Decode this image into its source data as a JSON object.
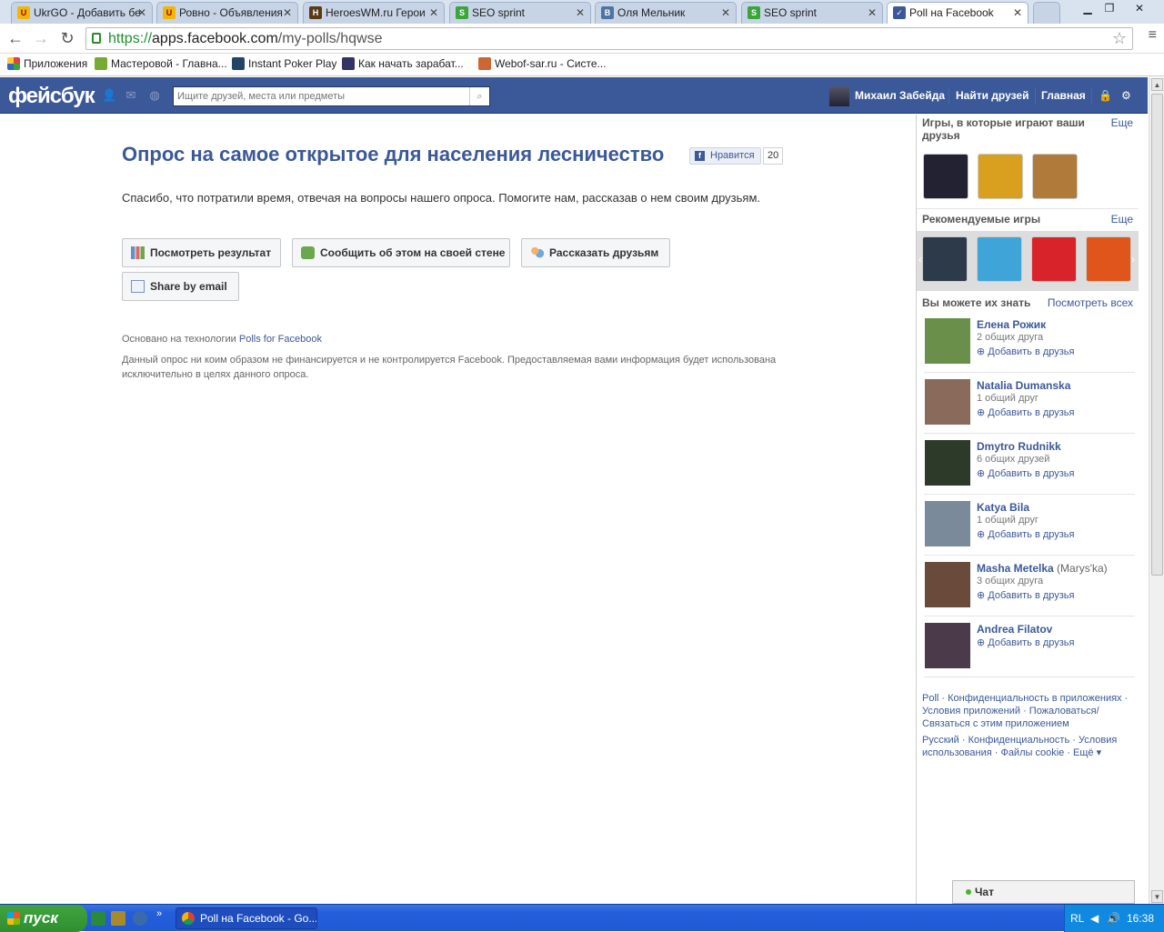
{
  "browser": {
    "tabs": [
      {
        "label": "UkrGO - Добавить бе",
        "icon": "ukrgo-icon",
        "color": "#f2b705"
      },
      {
        "label": "Ровно - Объявления",
        "icon": "ukrgo-icon",
        "color": "#f2b705"
      },
      {
        "label": "HeroesWM.ru Герои",
        "icon": "heroes-icon",
        "color": "#5a3a12"
      },
      {
        "label": "SEO sprint",
        "icon": "seosprint-icon",
        "color": "#3aa63a"
      },
      {
        "label": "Оля Мельник",
        "icon": "vk-icon",
        "color": "#4d75a3"
      },
      {
        "label": "SEO sprint",
        "icon": "seosprint-icon",
        "color": "#3aa63a"
      },
      {
        "label": "Poll на Facebook",
        "icon": "poll-icon",
        "color": "#3b5998"
      }
    ],
    "url": {
      "scheme": "https://",
      "host": "apps.facebook.com",
      "path": "/my-polls/hqwse"
    },
    "bookmarks": [
      {
        "label": "Приложения",
        "color": "#d44"
      },
      {
        "label": "Мастеровой - Главна...",
        "color": "#7a3"
      },
      {
        "label": "Instant Poker Play",
        "color": "#246"
      },
      {
        "label": "Как начать зарабат...",
        "color": "#336"
      },
      {
        "label": "Webof-sar.ru - Систе...",
        "color": "#c63"
      }
    ]
  },
  "fb": {
    "logo": "фейсбук",
    "search_placeholder": "Ищите друзей, места или предметы",
    "user_name": "Михаил Забейда",
    "nav_find_friends": "Найти друзей",
    "nav_home": "Главная"
  },
  "poll": {
    "title": "Опрос на самое открытое для населения лесничество",
    "like_label": "Нравится",
    "like_count": "20",
    "thanks": "Спасибо, что потратили время, отвечая на вопросы нашего опроса. Помогите нам, рассказав о нем своим друзьям.",
    "btn_results": "Посмотреть результат",
    "btn_wall": "Сообщить об этом на своей стене",
    "btn_tell": "Рассказать друзьям",
    "btn_email": "Share by email",
    "based_prefix": "Основано на технологии",
    "based_link": "Polls for Facebook",
    "disclaimer": "Данный опрос ни коим образом не финансируется и не контролируется Facebook. Предоставляемая вами информация будет использована исключительно в целях данного опроса."
  },
  "sidebar": {
    "friends_games_title": "Игры, в которые играют ваши друзья",
    "more": "Еще",
    "recommended_title": "Рекомендуемые игры",
    "pymk_title": "Вы можете их знать",
    "pymk_see_all": "Посмотреть всех",
    "friends_games": [
      {
        "name": "world-series-poker-icon",
        "color": "#223"
      },
      {
        "name": "candy-game-icon",
        "color": "#d9a020"
      },
      {
        "name": "hamster-game-icon",
        "color": "#b07a3a"
      }
    ],
    "recommended_games": [
      {
        "name": "pirates-game-icon",
        "color": "#2d3a4a"
      },
      {
        "name": "racing-game-icon",
        "color": "#3fa5d8"
      },
      {
        "name": "uno-friends-icon",
        "color": "#d8232a"
      },
      {
        "name": "fruit-frenzy-icon",
        "color": "#e0551b"
      }
    ],
    "people": [
      {
        "name": "Елена Рожик",
        "alt": "",
        "mutual": "2 общих друга",
        "add": "Добавить в друзья",
        "color": "#6a8f4a"
      },
      {
        "name": "Natalia Dumanska",
        "alt": "",
        "mutual": "1 общий друг",
        "add": "Добавить в друзья",
        "color": "#8a6a5a"
      },
      {
        "name": "Dmytro Rudnikk",
        "alt": "",
        "mutual": "6 общих друзей",
        "add": "Добавить в друзья",
        "color": "#2d3a2a"
      },
      {
        "name": "Katya Bila",
        "alt": "",
        "mutual": "1 общий друг",
        "add": "Добавить в друзья",
        "color": "#7a8a9a"
      },
      {
        "name": "Masha Metelka",
        "alt": "(Marys'ka)",
        "mutual": "3 общих друга",
        "add": "Добавить в друзья",
        "color": "#6a4a3a"
      },
      {
        "name": "Andrea Filatov",
        "alt": "",
        "mutual": "",
        "add": "Добавить в друзья",
        "color": "#4a3a4a"
      }
    ],
    "footer1": "Poll · Конфиденциальность в приложениях · Условия приложений · Пожаловаться/Связаться с этим приложением",
    "footer2": "Русский · Конфиденциальность · Условия использования · Файлы cookie · Ещё ▾"
  },
  "chat": {
    "label": "Чат"
  },
  "taskbar": {
    "start": "пуск",
    "task": "Poll на Facebook - Go...",
    "lang": "RL",
    "time": "16:38"
  }
}
